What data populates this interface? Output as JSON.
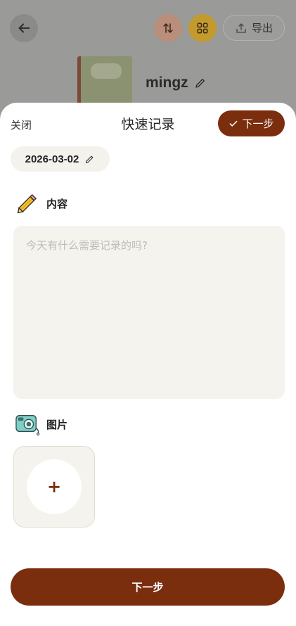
{
  "background": {
    "export_label": "导出",
    "notebook_name": "mingz",
    "icons": [
      "back-arrow-icon",
      "sort-icon",
      "grid-icon",
      "upload-icon",
      "edit-pencil-icon"
    ]
  },
  "sheet": {
    "close_label": "关闭",
    "title": "快速记录",
    "next_top_label": "下一步",
    "date": "2026-03-02",
    "content_label": "内容",
    "content_placeholder": "今天有什么需要记录的吗?",
    "image_label": "图片",
    "add_symbol": "+",
    "next_bottom_label": "下一步"
  },
  "colors": {
    "accent": "#7a2e0e",
    "chip_bg": "#f4f2ec",
    "input_bg": "#f4f3ee"
  }
}
